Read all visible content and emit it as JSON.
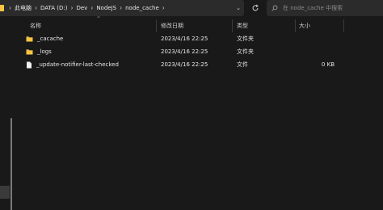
{
  "breadcrumb": {
    "items": [
      "此电脑",
      "DATA (D:)",
      "Dev",
      "NodeJS",
      "node_cache"
    ]
  },
  "search": {
    "placeholder": "在 node_cache 中搜索"
  },
  "columns": {
    "name": "名称",
    "modified": "修改日期",
    "type": "类型",
    "size": "大小"
  },
  "files": [
    {
      "name": "_cacache",
      "modified": "2023/4/16 22:25",
      "type": "文件夹",
      "size": "",
      "icon": "folder-icon"
    },
    {
      "name": "_logs",
      "modified": "2023/4/16 22:25",
      "type": "文件夹",
      "size": "",
      "icon": "folder-icon"
    },
    {
      "name": "_update-notifier-last-checked",
      "modified": "2023/4/16 22:25",
      "type": "文件",
      "size": "0 KB",
      "icon": "file-icon"
    }
  ],
  "colors": {
    "background": "#191919",
    "bar": "#2b2b2b",
    "folder": "#f5c542",
    "text": "#e6e6e6"
  }
}
